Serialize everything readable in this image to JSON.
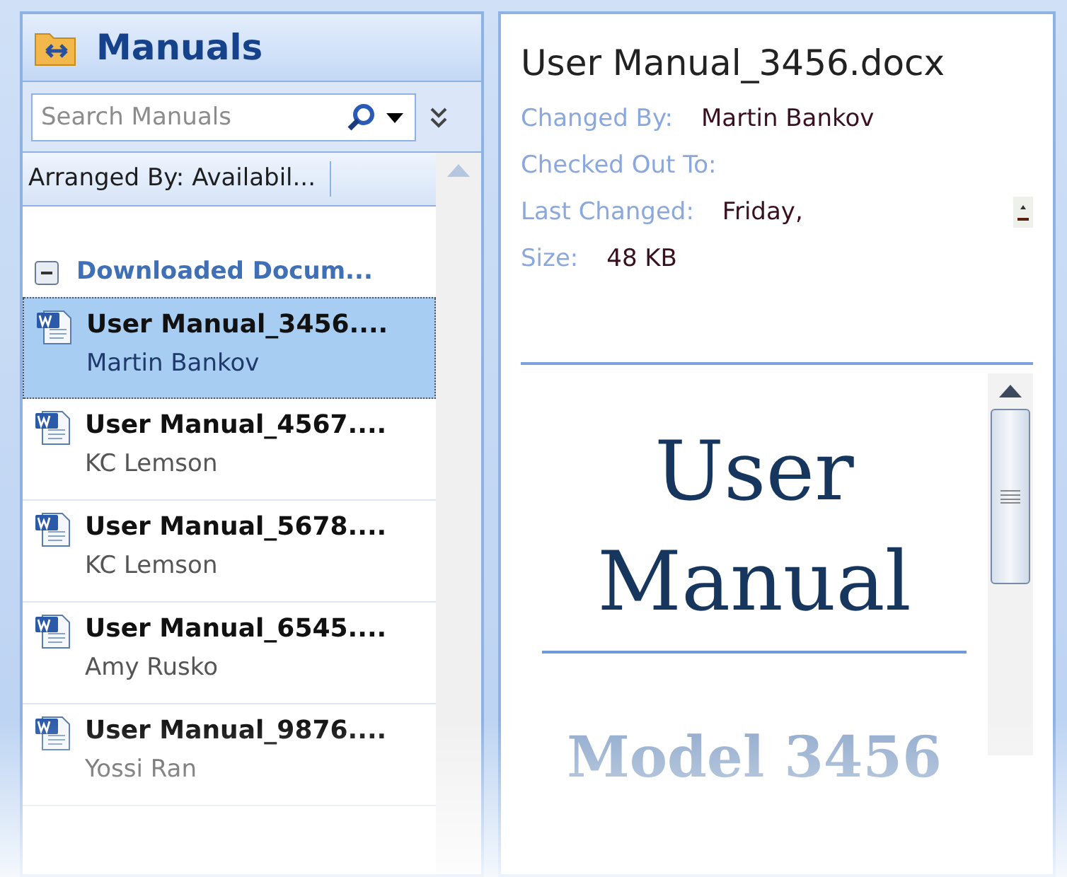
{
  "pane": {
    "title": "Manuals",
    "search": {
      "placeholder": "Search Manuals"
    },
    "arranged_by": "Arranged By: Availabil...",
    "group": {
      "label": "Downloaded Docum...",
      "expanded": true
    },
    "items": [
      {
        "name": "User Manual_3456....",
        "author": "Martin Bankov",
        "selected": true
      },
      {
        "name": "User Manual_4567....",
        "author": "KC Lemson",
        "selected": false
      },
      {
        "name": "User Manual_5678....",
        "author": "KC Lemson",
        "selected": false
      },
      {
        "name": "User Manual_6545....",
        "author": "Amy Rusko",
        "selected": false
      },
      {
        "name": "User Manual_9876....",
        "author": "Yossi Ran",
        "selected": false
      }
    ]
  },
  "details": {
    "title": "User Manual_3456.docx",
    "properties": [
      {
        "label": "Changed By:",
        "value": "Martin Bankov"
      },
      {
        "label": "Checked Out To:"
      },
      {
        "label": "Last Changed:",
        "value": "Friday,"
      },
      {
        "label": "Size:",
        "value": "48 KB"
      }
    ]
  },
  "preview": {
    "title": "User Manual",
    "subtitle": "Model 3456"
  }
}
